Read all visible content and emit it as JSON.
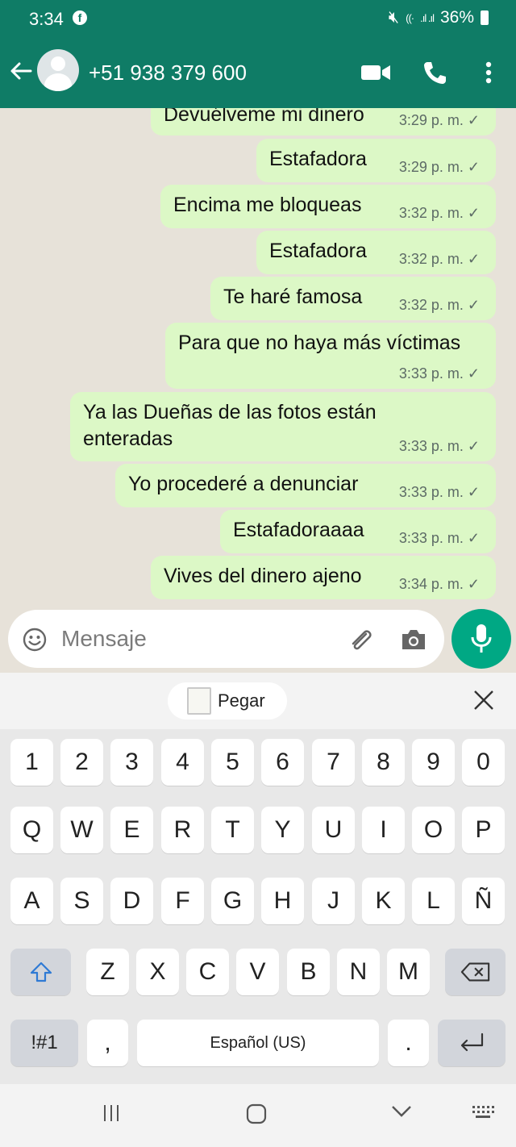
{
  "status_bar": {
    "time": "3:34",
    "battery": "36%"
  },
  "header": {
    "contact": "+51 938 379 600"
  },
  "messages": [
    {
      "text": "Devuélveme mi dinero",
      "time": "3:29 p. m."
    },
    {
      "text": "Estafadora",
      "time": "3:29 p. m."
    },
    {
      "text": "Encima me bloqueas",
      "time": "3:32 p. m."
    },
    {
      "text": "Estafadora",
      "time": "3:32 p. m."
    },
    {
      "text": "Te haré famosa",
      "time": "3:32 p. m."
    },
    {
      "text": "Para que no haya más víctimas",
      "time": "3:33 p. m."
    },
    {
      "text": "Ya las Dueñas de las fotos están enteradas",
      "time": "3:33 p. m."
    },
    {
      "text": "Yo procederé a denunciar",
      "time": "3:33 p. m."
    },
    {
      "text": "Estafadoraaaa",
      "time": "3:33 p. m."
    },
    {
      "text": "Vives del dinero ajeno",
      "time": "3:34 p. m."
    }
  ],
  "tick": "✓",
  "input": {
    "placeholder": "Mensaje"
  },
  "keyboard": {
    "paste_label": "Pegar",
    "row_numbers": [
      "1",
      "2",
      "3",
      "4",
      "5",
      "6",
      "7",
      "8",
      "9",
      "0"
    ],
    "row_1": [
      "Q",
      "W",
      "E",
      "R",
      "T",
      "Y",
      "U",
      "I",
      "O",
      "P"
    ],
    "row_2": [
      "A",
      "S",
      "D",
      "F",
      "G",
      "H",
      "J",
      "K",
      "L",
      "Ñ"
    ],
    "row_3": [
      "Z",
      "X",
      "C",
      "V",
      "B",
      "N",
      "M"
    ],
    "symbols_label": "!#1",
    "comma": ",",
    "space_label": "Español (US)",
    "period": "."
  },
  "colors": {
    "header": "#0f7c66",
    "outgoing_bubble": "#dcf8c6",
    "mic": "#00a884"
  }
}
